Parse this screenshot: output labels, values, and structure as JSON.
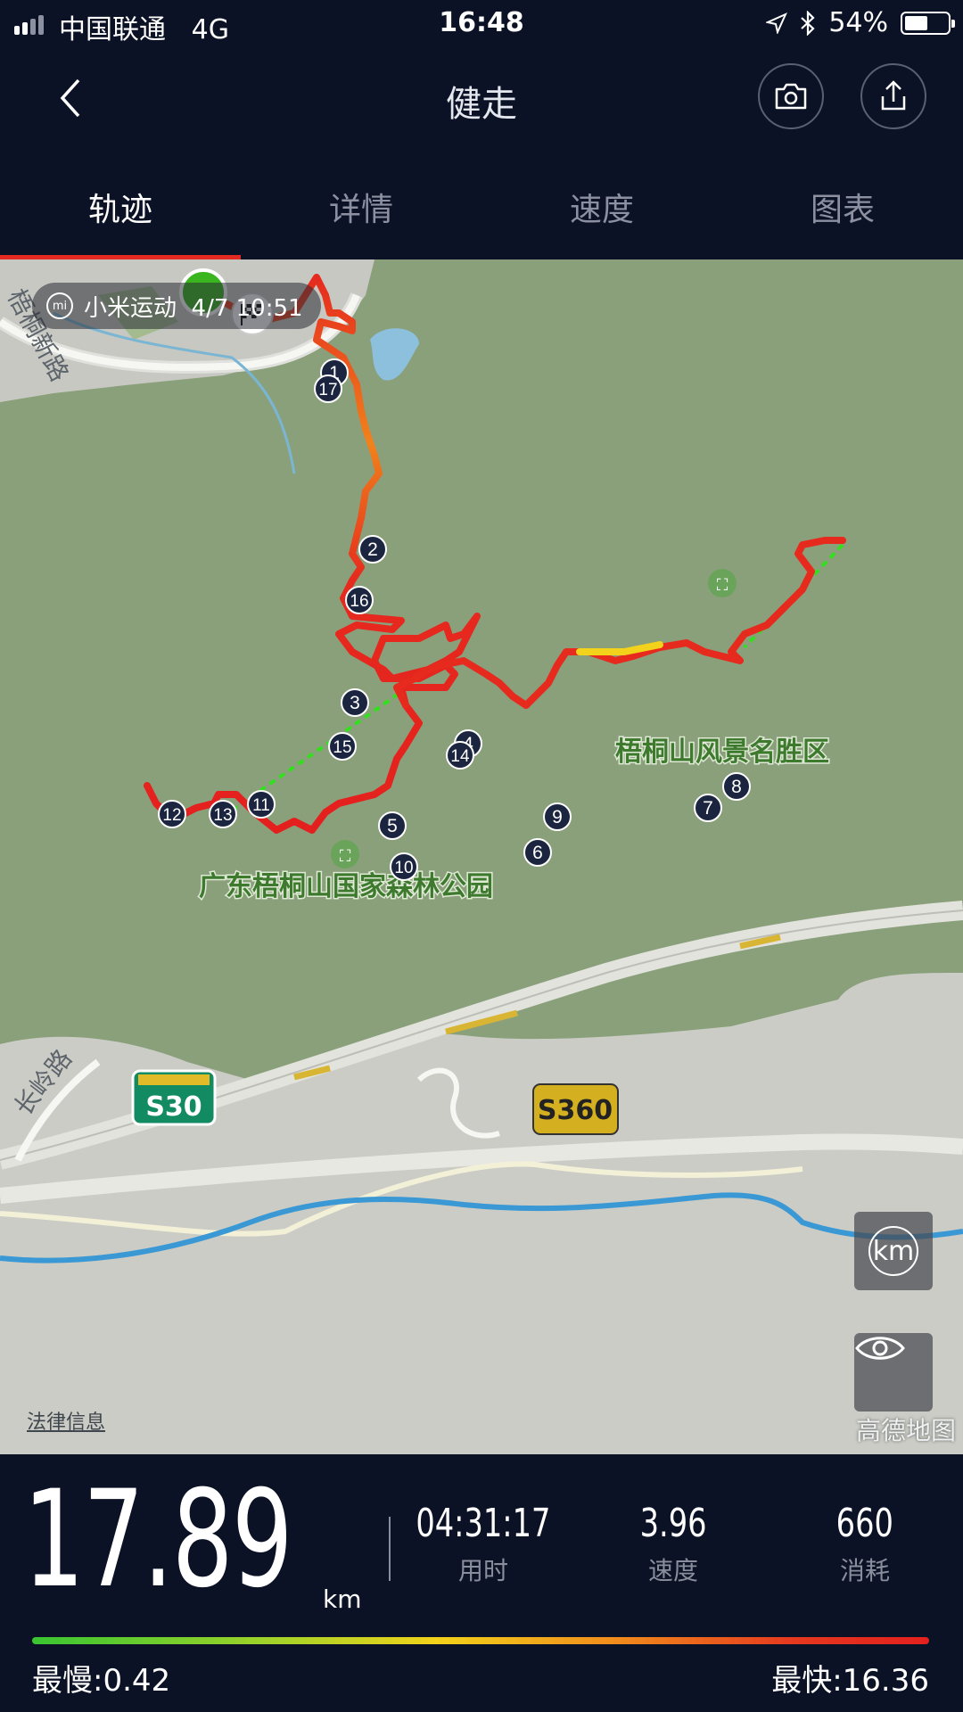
{
  "status": {
    "carrier": "中国联通",
    "network": "4G",
    "time": "16:48",
    "battery": "54%",
    "battery_level": 0.54
  },
  "nav": {
    "title": "健走",
    "back_icon": "chevron-left-icon",
    "camera_icon": "camera-icon",
    "share_icon": "upload-icon"
  },
  "tabs": [
    {
      "label": "轨迹",
      "active": true
    },
    {
      "label": "详情",
      "active": false
    },
    {
      "label": "速度",
      "active": false
    },
    {
      "label": "图表",
      "active": false
    }
  ],
  "map": {
    "source_label": "小米运动  4/7 10:51",
    "roads": [
      "梧桐新路",
      "长岭路"
    ],
    "pois": [
      "梧桐山风景名胜区",
      "广东梧桐山国家森林公园"
    ],
    "highways": [
      "S30",
      "S360"
    ],
    "km_button": "km",
    "legal": "法律信息",
    "provider": "高德地图",
    "markers": [
      "1",
      "17",
      "2",
      "16",
      "3",
      "15",
      "4",
      "14",
      "5",
      "10",
      "6",
      "9",
      "7",
      "8",
      "11",
      "13",
      "12"
    ]
  },
  "stats": {
    "distance": "17.89",
    "distance_unit": "km",
    "duration": "04:31:17",
    "duration_label": "用时",
    "speed": "3.96",
    "speed_label": "速度",
    "calories": "660",
    "calories_label": "消耗",
    "slowest": "最慢:0.42",
    "fastest": "最快:16.36"
  },
  "colors": {
    "background": "#0c1226",
    "accent": "#e32a22",
    "track_fast": "#e4201e",
    "track_slow": "#39c531"
  }
}
